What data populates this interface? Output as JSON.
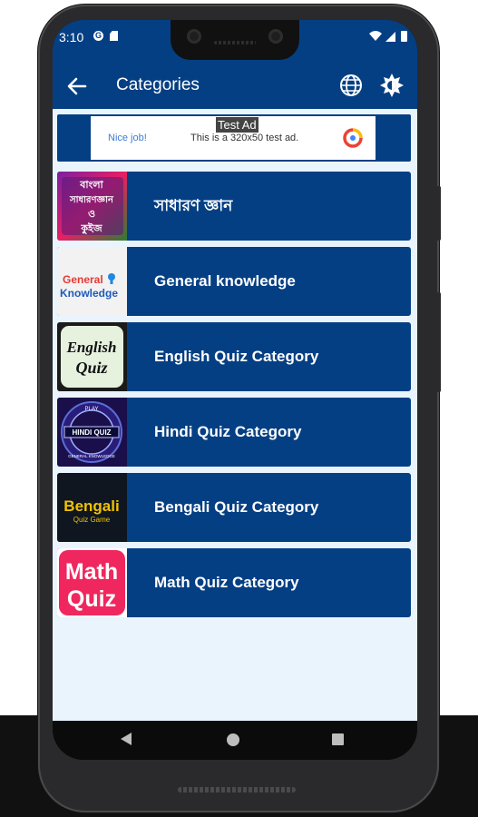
{
  "status_bar": {
    "time": "3:10",
    "left_icons": [
      "google-g-icon",
      "sd-card-icon"
    ],
    "right_icons": [
      "wifi-icon",
      "signal-icon",
      "battery-icon"
    ]
  },
  "app_bar": {
    "title": "Categories",
    "back_icon": "arrow-back-icon",
    "actions": [
      "globe-icon",
      "brightness-icon"
    ]
  },
  "ad": {
    "label": "Test Ad",
    "nice": "Nice job!",
    "text": "This is a 320x50 test ad.",
    "logo": "admob-logo-icon"
  },
  "categories": [
    {
      "label": "সাধারণ জ্ঞান",
      "thumb_text": [
        "বাংলা",
        "সাধারণজ্ঞান",
        "ও",
        "কুইজ"
      ]
    },
    {
      "label": "General knowledge",
      "thumb_text": [
        "General",
        "Knowledge"
      ]
    },
    {
      "label": "English Quiz Category",
      "thumb_text": [
        "English",
        "Quiz"
      ]
    },
    {
      "label": "Hindi Quiz Category",
      "thumb_text": [
        "PLAY",
        "HINDI QUIZ",
        "GENERAL KNOWLEDGE"
      ]
    },
    {
      "label": "Bengali Quiz Category",
      "thumb_text": [
        "Bengali",
        "Quiz Game"
      ]
    },
    {
      "label": "Math Quiz Category",
      "thumb_text": [
        "Math",
        "Quiz"
      ]
    }
  ],
  "nav_bar": [
    "back-triangle-icon",
    "home-circle-icon",
    "recents-square-icon"
  ],
  "colors": {
    "app_bar": "#053f83",
    "content_bg": "#e9f4fd",
    "item_bg": "#053f83",
    "text": "#ffffff"
  }
}
